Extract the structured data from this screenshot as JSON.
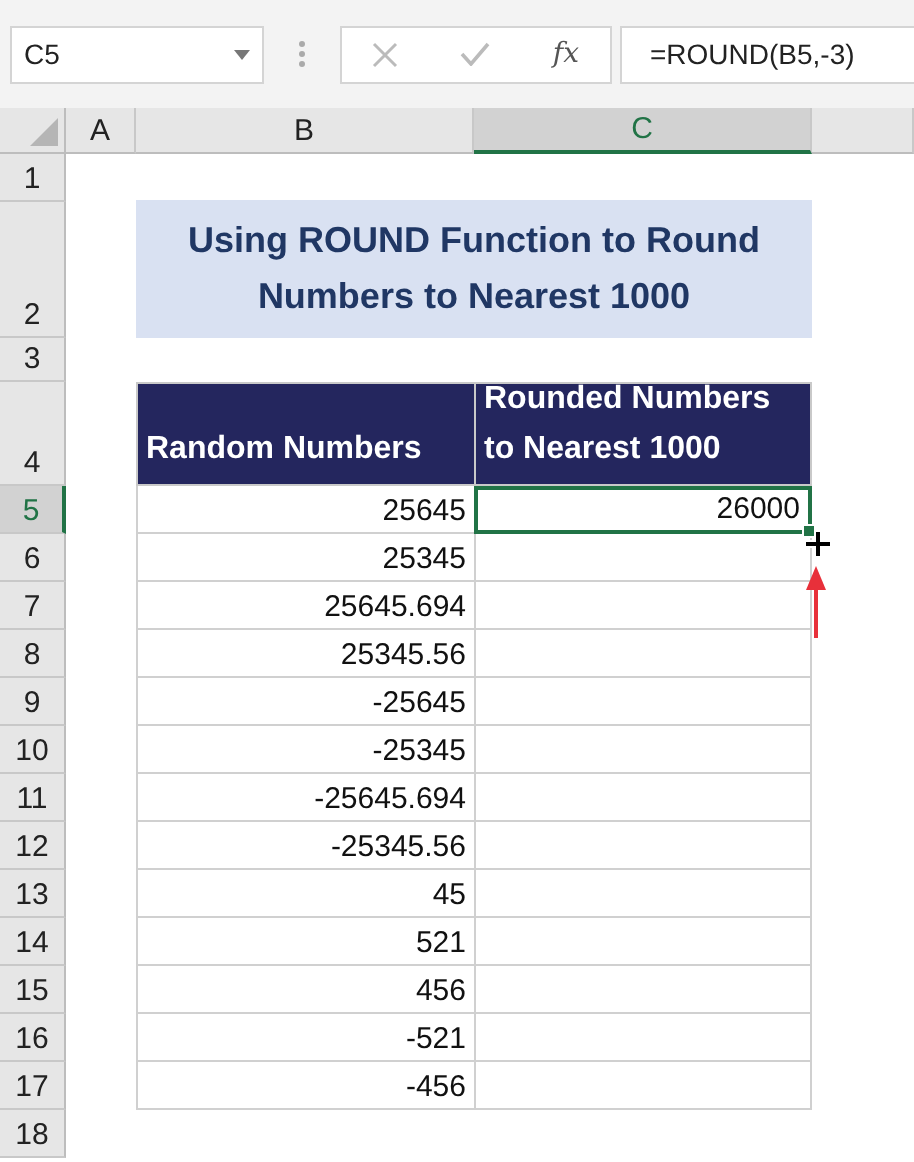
{
  "name_box": {
    "value": "C5"
  },
  "formula_bar": {
    "fx_label": "fx",
    "formula": "=ROUND(B5,-3)"
  },
  "column_headers": [
    {
      "label": "A",
      "selected": false
    },
    {
      "label": "B",
      "selected": false
    },
    {
      "label": "C",
      "selected": true
    }
  ],
  "row_headers": [
    {
      "label": "1",
      "selected": false
    },
    {
      "label": "2",
      "selected": false
    },
    {
      "label": "3",
      "selected": false
    },
    {
      "label": "4",
      "selected": false
    },
    {
      "label": "5",
      "selected": true
    },
    {
      "label": "6",
      "selected": false
    },
    {
      "label": "7",
      "selected": false
    },
    {
      "label": "8",
      "selected": false
    },
    {
      "label": "9",
      "selected": false
    },
    {
      "label": "10",
      "selected": false
    },
    {
      "label": "11",
      "selected": false
    },
    {
      "label": "12",
      "selected": false
    },
    {
      "label": "13",
      "selected": false
    },
    {
      "label": "14",
      "selected": false
    },
    {
      "label": "15",
      "selected": false
    },
    {
      "label": "16",
      "selected": false
    },
    {
      "label": "17",
      "selected": false
    },
    {
      "label": "18",
      "selected": false
    }
  ],
  "title": "Using ROUND Function to Round Numbers to Nearest 1000",
  "table": {
    "columns": [
      "Random Numbers",
      "Rounded Numbers to Nearest 1000"
    ],
    "rows": [
      {
        "value": "25645",
        "result": "26000",
        "selected": true
      },
      {
        "value": "25345",
        "selected": false
      },
      {
        "value": "25645.694",
        "selected": false
      },
      {
        "value": "25345.56",
        "selected": false
      },
      {
        "value": "-25645",
        "selected": false
      },
      {
        "value": "-25345",
        "selected": false
      },
      {
        "value": "-25645.694",
        "selected": false
      },
      {
        "value": "-25345.56",
        "selected": false
      },
      {
        "value": "45",
        "selected": false
      },
      {
        "value": "521",
        "selected": false
      },
      {
        "value": "456",
        "selected": false
      },
      {
        "value": "-521",
        "selected": false
      },
      {
        "value": "-456",
        "selected": false
      }
    ]
  }
}
